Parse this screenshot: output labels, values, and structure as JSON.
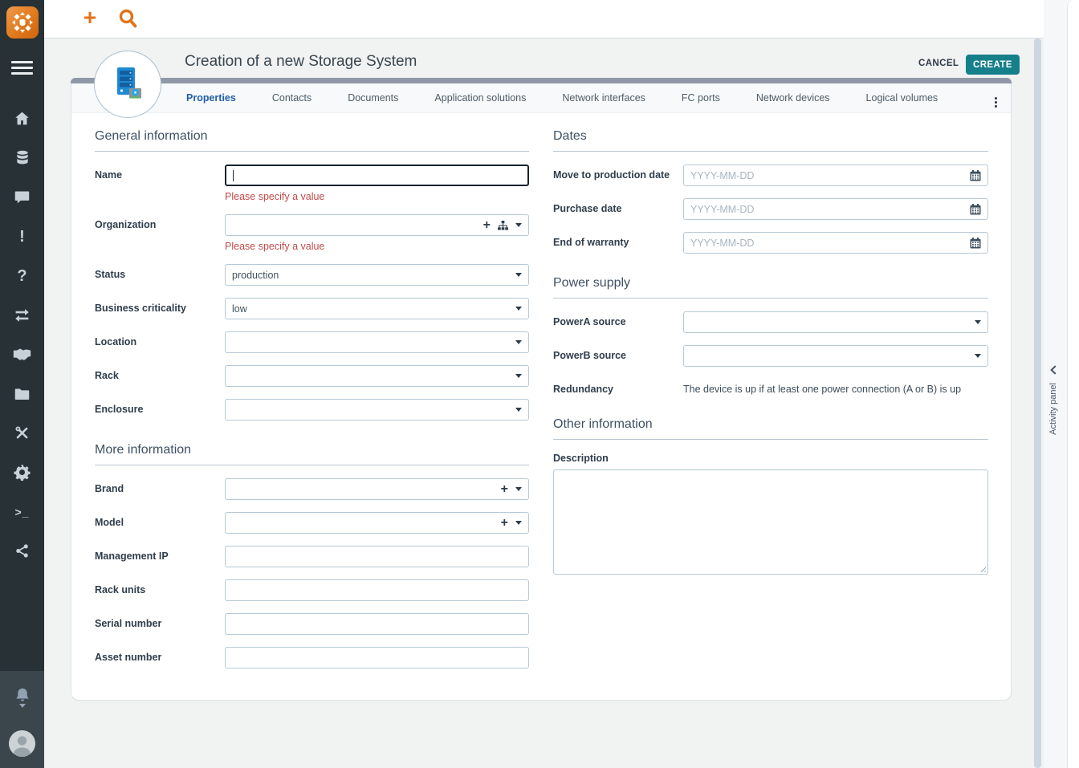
{
  "header": {
    "title": "Creation of a new Storage System",
    "cancel_label": "CANCEL",
    "create_label": "CREATE"
  },
  "tabs": [
    {
      "label": "Properties",
      "active": true
    },
    {
      "label": "Contacts",
      "active": false
    },
    {
      "label": "Documents",
      "active": false
    },
    {
      "label": "Application solutions",
      "active": false
    },
    {
      "label": "Network interfaces",
      "active": false
    },
    {
      "label": "FC ports",
      "active": false
    },
    {
      "label": "Network devices",
      "active": false
    },
    {
      "label": "Logical volumes",
      "active": false
    }
  ],
  "sections": {
    "general": "General information",
    "more": "More information",
    "dates": "Dates",
    "power": "Power supply",
    "other": "Other information"
  },
  "fields": {
    "name": {
      "label": "Name",
      "value": "",
      "error": "Please specify a value"
    },
    "organization": {
      "label": "Organization",
      "value": "",
      "error": "Please specify a value"
    },
    "status": {
      "label": "Status",
      "value": "production"
    },
    "business_criticality": {
      "label": "Business criticality",
      "value": "low"
    },
    "location": {
      "label": "Location",
      "value": ""
    },
    "rack": {
      "label": "Rack",
      "value": ""
    },
    "enclosure": {
      "label": "Enclosure",
      "value": ""
    },
    "brand": {
      "label": "Brand",
      "value": ""
    },
    "model": {
      "label": "Model",
      "value": ""
    },
    "management_ip": {
      "label": "Management IP",
      "value": ""
    },
    "rack_units": {
      "label": "Rack units",
      "value": ""
    },
    "serial_number": {
      "label": "Serial number",
      "value": ""
    },
    "asset_number": {
      "label": "Asset number",
      "value": ""
    },
    "move_to_production": {
      "label": "Move to production date",
      "value": "",
      "placeholder": "YYYY-MM-DD"
    },
    "purchase_date": {
      "label": "Purchase date",
      "value": "",
      "placeholder": "YYYY-MM-DD"
    },
    "end_of_warranty": {
      "label": "End of warranty",
      "value": "",
      "placeholder": "YYYY-MM-DD"
    },
    "powera_source": {
      "label": "PowerA source",
      "value": ""
    },
    "powerb_source": {
      "label": "PowerB source",
      "value": ""
    },
    "redundancy": {
      "label": "Redundancy",
      "value": "The device is up if at least one power connection (A or B) is up"
    },
    "description": {
      "label": "Description",
      "value": ""
    }
  },
  "activity_panel": {
    "label": "Activity panel"
  },
  "sidebar": {
    "icons": [
      "app-logo",
      "menu-icon",
      "home-icon",
      "database-icon",
      "chat-icon",
      "alert-icon",
      "help-icon",
      "exchange-icon",
      "handshake-icon",
      "folder-icon",
      "tools-icon",
      "gear-icon",
      "terminal-icon",
      "share-icon",
      "bell-icon",
      "user-avatar"
    ]
  },
  "topbar": {
    "icons": [
      "add-icon",
      "search-icon"
    ]
  },
  "colors": {
    "accent_orange": "#e2731c",
    "primary_teal": "#157f8a",
    "sidebar_bg": "#273136",
    "active_tab_blue": "#2160a8",
    "error_red": "#c24b4b",
    "card_top_bar": "#8e98a6"
  }
}
